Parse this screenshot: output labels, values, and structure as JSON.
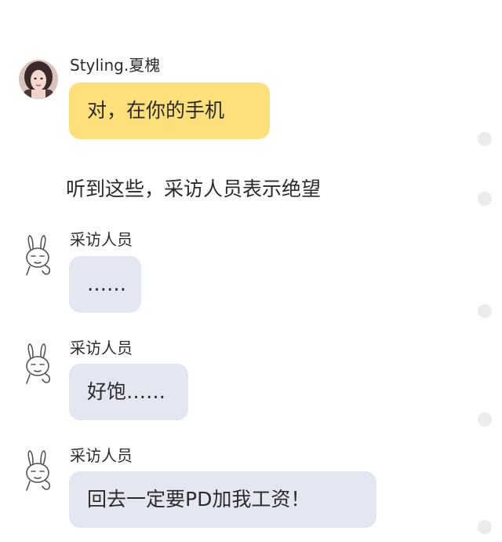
{
  "messages": [
    {
      "sender": "Styling.夏槐",
      "text": "对，在你的手机"
    },
    {
      "narration": "听到这些，采访人员表示绝望"
    },
    {
      "sender": "采访人员",
      "text": "……"
    },
    {
      "sender": "采访人员",
      "text": "好饱……"
    },
    {
      "sender": "采访人员",
      "text": "回去一定要PD加我工资！"
    }
  ],
  "colors": {
    "yellow_bubble": "#fde07a",
    "gray_bubble": "#e4e7f1",
    "scroll_dot": "#ececec"
  },
  "icons": {
    "avatar_1": "woman-portrait-avatar",
    "avatar_2": "rabbit-sticker-avatar"
  }
}
